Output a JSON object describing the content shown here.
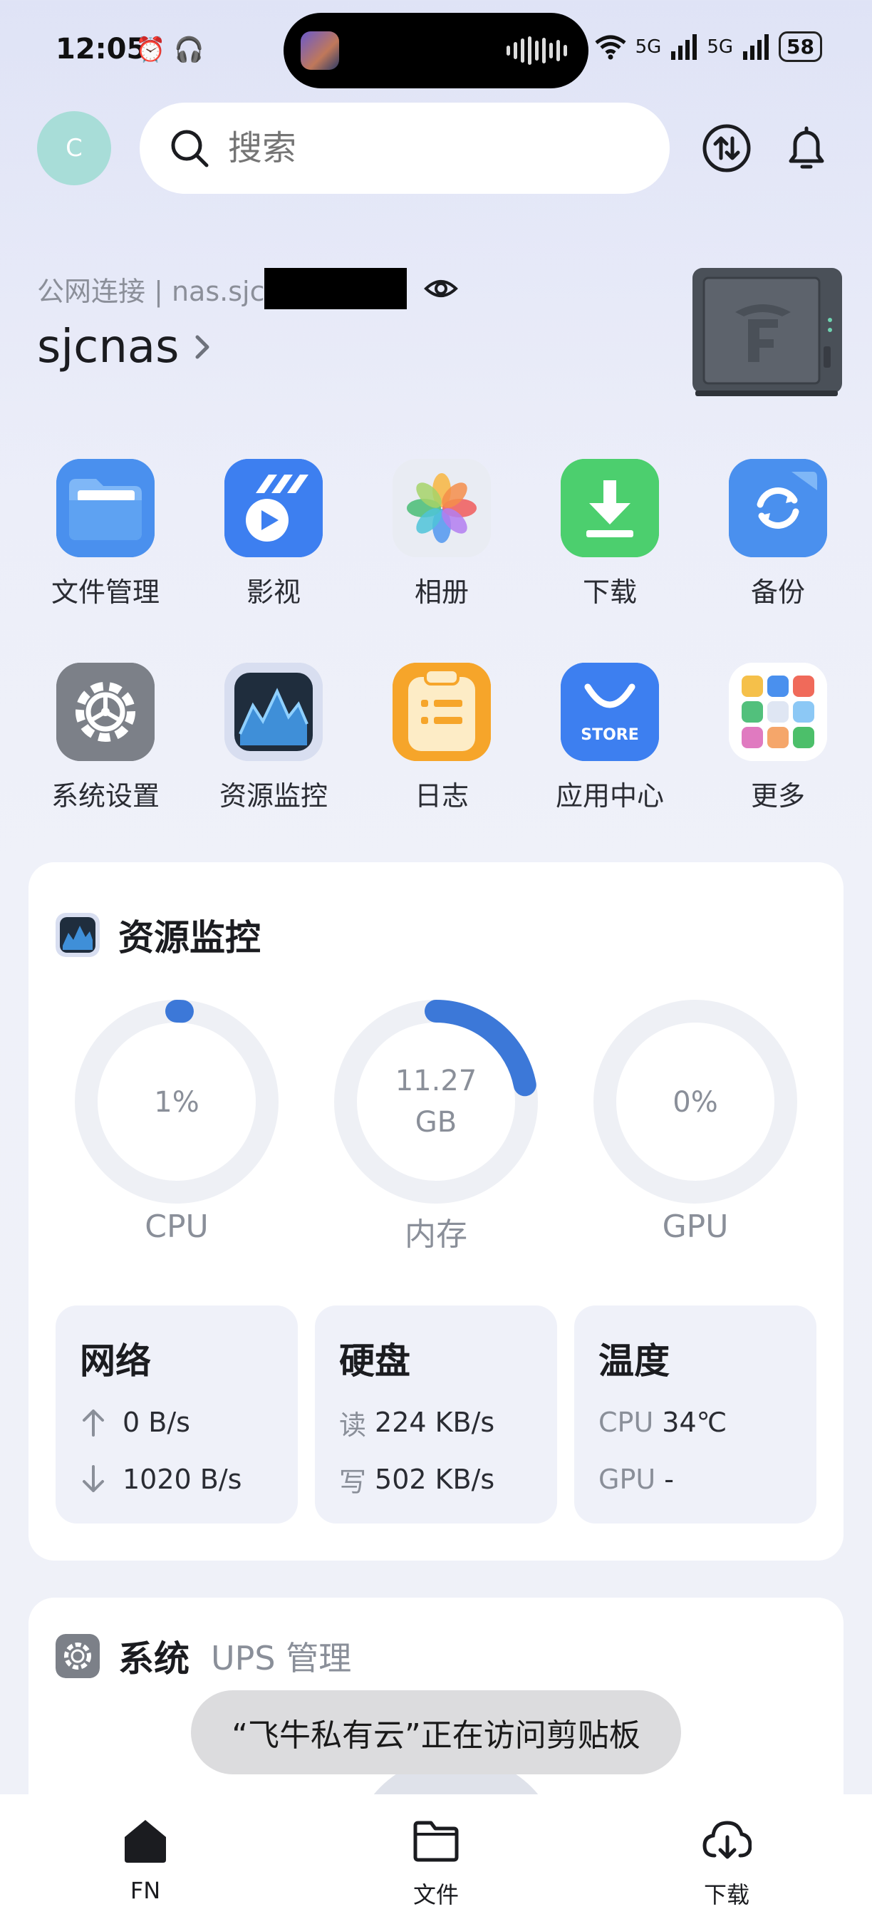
{
  "status_bar": {
    "time": "12:05",
    "battery": "58",
    "network_1": "5G",
    "network_2": "5G"
  },
  "header": {
    "avatar_letter": "C",
    "search_placeholder": "搜索"
  },
  "nas": {
    "connection_text": "公网连接 | nas.sjc",
    "name": "sjcnas"
  },
  "apps": [
    {
      "label": "文件管理",
      "icon": "folder-icon"
    },
    {
      "label": "影视",
      "icon": "video-icon"
    },
    {
      "label": "相册",
      "icon": "photos-icon"
    },
    {
      "label": "下载",
      "icon": "download-icon"
    },
    {
      "label": "备份",
      "icon": "backup-icon"
    },
    {
      "label": "系统设置",
      "icon": "settings-icon"
    },
    {
      "label": "资源监控",
      "icon": "monitor-icon"
    },
    {
      "label": "日志",
      "icon": "log-icon"
    },
    {
      "label": "应用中心",
      "icon": "store-icon"
    },
    {
      "label": "更多",
      "icon": "more-icon"
    }
  ],
  "store_badge": "STORE",
  "resource": {
    "title": "资源监控",
    "gauges": [
      {
        "label": "CPU",
        "value": "1%",
        "fraction": 0.01
      },
      {
        "label": "内存",
        "value": "11.27\nGB",
        "fraction": 0.22
      },
      {
        "label": "GPU",
        "value": "0%",
        "fraction": 0
      }
    ],
    "network": {
      "title": "网络",
      "up": "0 B/s",
      "down": "1020 B/s"
    },
    "disk": {
      "title": "硬盘",
      "read_key": "读",
      "read": "224 KB/s",
      "write_key": "写",
      "write": "502 KB/s"
    },
    "temp": {
      "title": "温度",
      "cpu_key": "CPU",
      "cpu": "34℃",
      "gpu_key": "GPU",
      "gpu": "-"
    }
  },
  "system": {
    "title": "系统",
    "subtitle": "UPS 管理"
  },
  "toast": "“飞牛私有云”正在访问剪贴板",
  "bottom_nav": [
    {
      "label": "FN"
    },
    {
      "label": "文件"
    },
    {
      "label": "下载"
    }
  ],
  "colors": {
    "accent": "#3c78d8",
    "gauge_track": "#eef0f5",
    "card_bg": "#ffffff",
    "page_bg": "#eceef9"
  }
}
